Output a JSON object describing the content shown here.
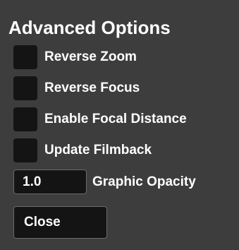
{
  "panel": {
    "title": "Advanced Options",
    "options": [
      {
        "label": "Reverse Zoom",
        "checked": false
      },
      {
        "label": "Reverse Focus",
        "checked": false
      },
      {
        "label": "Enable Focal Distance",
        "checked": false
      },
      {
        "label": "Update Filmback",
        "checked": false
      }
    ],
    "opacity": {
      "value": "1.0",
      "label": "Graphic Opacity"
    },
    "close_label": "Close"
  }
}
